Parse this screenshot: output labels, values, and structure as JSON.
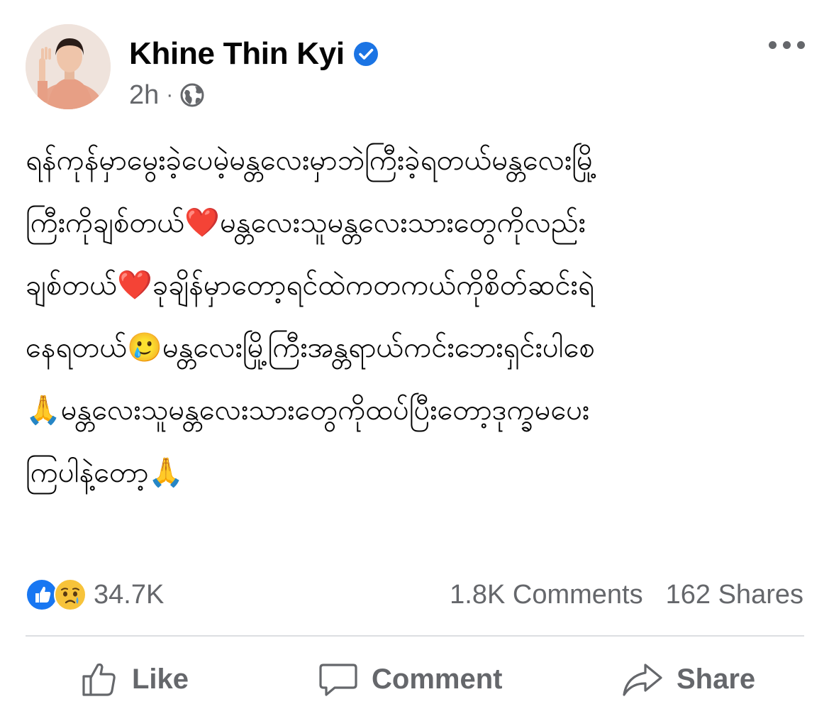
{
  "author": {
    "name": "Khine Thin Kyi",
    "verified": true,
    "timestamp": "2h",
    "separator": "·",
    "audience_icon": "globe-icon",
    "menu_icon": "more-horizontal-icon"
  },
  "post": {
    "lines": [
      "ရန်ကုန်မှာမွေးခဲ့ပေမဲ့မန္တလေးမှာဘဲကြီးခဲ့ရတယ်မန္တလေးမြို့",
      "ကြီးကိုချစ်တယ်❤️မန္တလေးသူမန္တလေးသားတွေကိုလည်း",
      "ချစ်တယ်❤️ခုချိန်မှာတော့ရင်ထဲကတကယ်ကိုစိတ်ဆင်းရဲ",
      "နေရတယ်🥲မန္တလေးမြို့ကြီးအန္တရာယ်ကင်းဘေးရှင်းပါစေ",
      "🙏မန္တလေးသူမန္တလေးသားတွေကိုထပ်ပြီးတော့ဒုက္ခမပေး",
      "ကြပါနဲ့တော့🙏"
    ]
  },
  "reactions": {
    "icons": [
      "like-reaction-icon",
      "sad-reaction-icon"
    ],
    "count": "34.7K"
  },
  "stats": {
    "comments": "1.8K Comments",
    "shares": "162 Shares"
  },
  "actions": {
    "like": "Like",
    "comment": "Comment",
    "share": "Share"
  },
  "colors": {
    "verified_blue": "#1b74e4",
    "secondary_text": "#65676b",
    "divider": "#dcdee2",
    "like_blue": "#1877f2",
    "sad_yellow": "#f7c33a"
  }
}
